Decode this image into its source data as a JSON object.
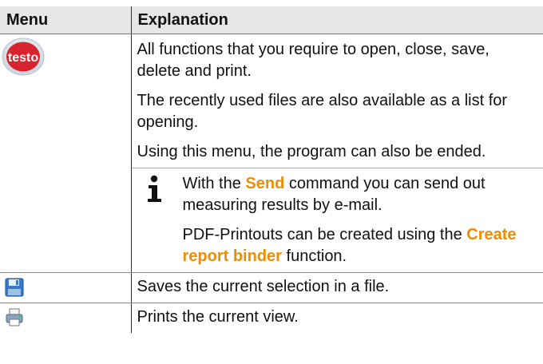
{
  "table": {
    "header_menu": "Menu",
    "header_explanation": "Explanation",
    "rows": [
      {
        "icon": "testo-logo-icon",
        "logo_text": "testo",
        "paragraphs": [
          "All functions that you require to open, close, save, delete and print.",
          "The recently used files are also available as a list for opening.",
          "Using this menu, the program can also be ended."
        ],
        "note": {
          "icon": "info-icon",
          "line1_prefix": "With the ",
          "line1_command": "Send",
          "line1_suffix": " command you can send out measuring results by e-mail.",
          "line2_prefix": "PDF-Printouts can be created using the ",
          "line2_command": "Create report binder",
          "line2_suffix": " function."
        }
      },
      {
        "icon": "save-disk-icon",
        "text": "Saves the current selection in a file."
      },
      {
        "icon": "printer-icon",
        "text": "Prints the current view."
      }
    ]
  },
  "colors": {
    "command_highlight": "#f08c00",
    "header_background": "#e6e6e6",
    "logo_red": "#d9232e"
  }
}
